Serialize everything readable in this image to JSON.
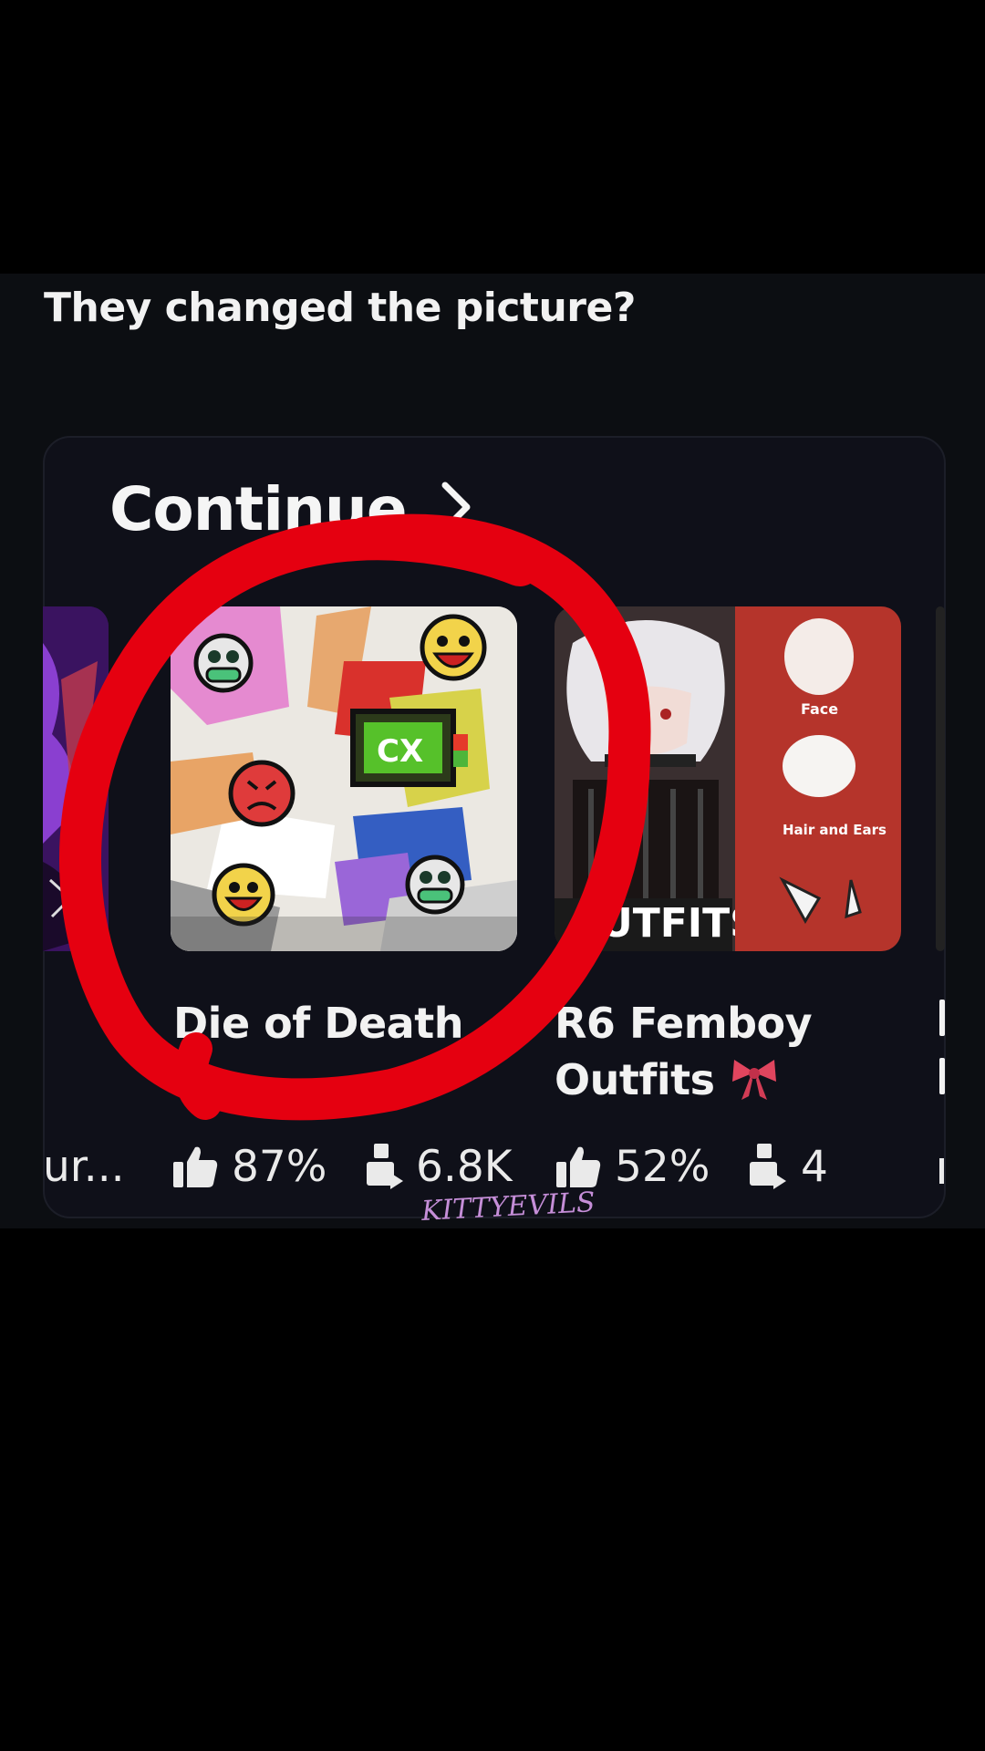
{
  "post": {
    "caption": "They changed the picture?"
  },
  "section": {
    "title": "Continue",
    "chevron_icon": "chevron-right-icon"
  },
  "games": [
    {
      "title": "",
      "truncated_subtitle": "ur...",
      "position": "left-partial"
    },
    {
      "title": "Die of Death",
      "like_ratio": "87%",
      "players": "6.8K"
    },
    {
      "title_line1": "R6 Femboy",
      "title_line2": "Outfits",
      "bow_icon": "ribbon-bow-icon",
      "like_ratio": "52%",
      "players": "4",
      "thumb_text": "UTFITS",
      "thumb_side_labels": [
        "Face",
        "Hair and Ears"
      ]
    }
  ],
  "annotation": {
    "circle_color": "#e50010"
  },
  "watermark": "KITTYEVILS"
}
